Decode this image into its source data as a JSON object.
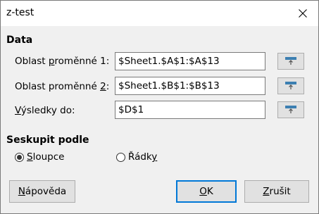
{
  "window": {
    "title": "z-test",
    "close_icon": "close-icon"
  },
  "data_section": {
    "heading": "Data",
    "variable1": {
      "label_pre": "Oblast ",
      "label_mnemonic": "p",
      "label_post": "roměnné 1:",
      "value": "$Sheet1.$A$1:$A$13",
      "shrink_icon": "shrink-icon"
    },
    "variable2": {
      "label_pre": "Oblast proměnné ",
      "label_mnemonic": "2",
      "label_post": ":",
      "value": "$Sheet1.$B$1:$B$13",
      "shrink_icon": "shrink-icon"
    },
    "results": {
      "label_pre": "",
      "label_mnemonic": "V",
      "label_post": "ýsledky do:",
      "value": "$D$1",
      "shrink_icon": "shrink-icon"
    }
  },
  "group_by": {
    "heading": "Seskupit podle",
    "columns": {
      "label_mnemonic": "S",
      "label_post": "loupce",
      "checked": true
    },
    "rows": {
      "label_pre": "Řádk",
      "label_mnemonic": "y",
      "checked": false
    }
  },
  "buttons": {
    "help": {
      "label_mnemonic": "N",
      "label_post": "ápověda"
    },
    "ok": {
      "label_mnemonic": "O",
      "label_post": "K"
    },
    "cancel": {
      "label_mnemonic": "Z",
      "label_post": "rušit"
    }
  },
  "colors": {
    "dialog_background": "#f0f0f0",
    "titlebar_background": "#ffffff",
    "default_button_border": "#0078d7",
    "button_background": "#e1e1e1"
  }
}
